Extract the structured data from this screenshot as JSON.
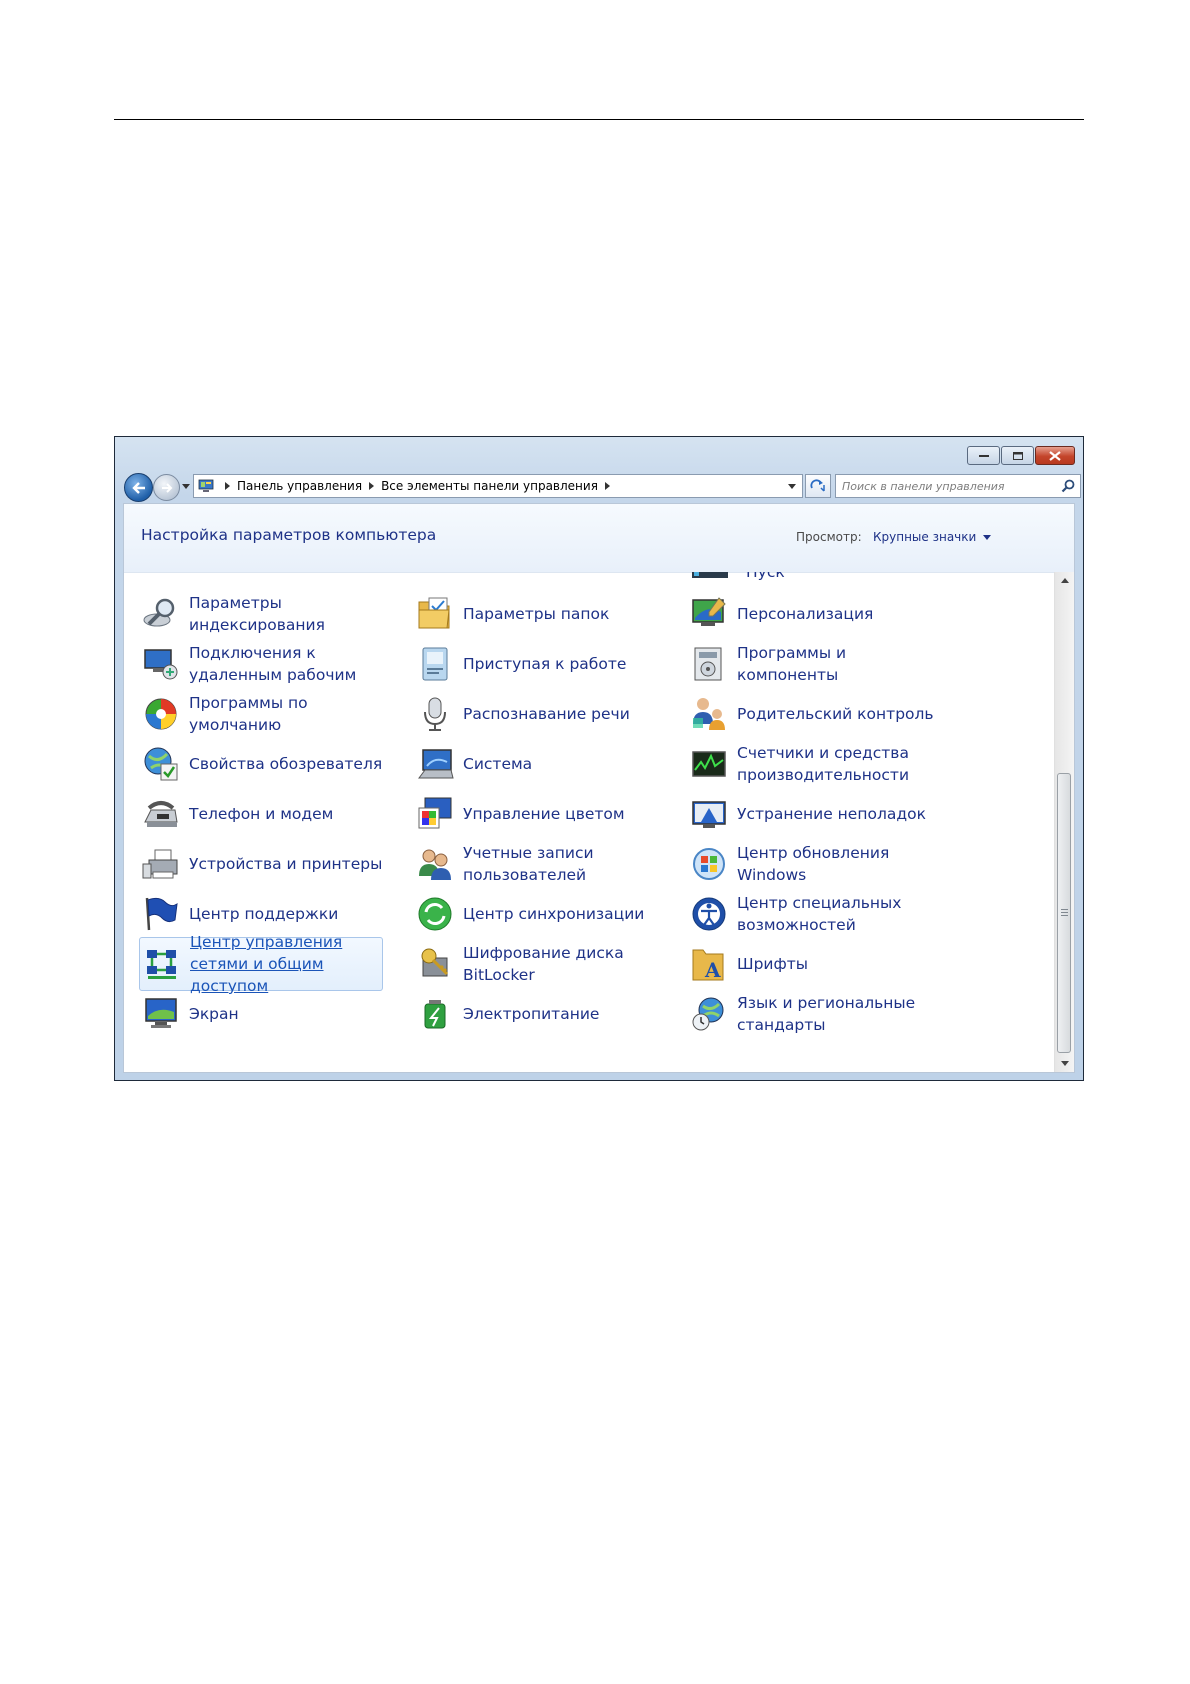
{
  "window": {
    "controls": [
      "minimize",
      "maximize",
      "close"
    ],
    "address_path": [
      "Панель управления",
      "Все элементы панели управления"
    ],
    "search_placeholder": "Поиск в панели управления"
  },
  "header": {
    "title": "Настройка параметров компьютера",
    "view_label": "Просмотр:",
    "view_value": "Крупные значки"
  },
  "partial_top": {
    "col1": "",
    "col2": "",
    "col3": "Пуск"
  },
  "items": {
    "col1": [
      {
        "label": "Параметры индексирования",
        "icon": "indexing-options-icon"
      },
      {
        "label": "Подключения к удаленным рабочим",
        "icon": "remote-desktop-icon"
      },
      {
        "label": "Программы по умолчанию",
        "icon": "default-programs-icon"
      },
      {
        "label": "Свойства обозревателя",
        "icon": "internet-options-icon"
      },
      {
        "label": "Телефон и модем",
        "icon": "phone-modem-icon"
      },
      {
        "label": "Устройства и принтеры",
        "icon": "devices-printers-icon"
      },
      {
        "label": "Центр поддержки",
        "icon": "action-center-flag-icon"
      },
      {
        "label": "Центр управления сетями и общим доступом",
        "icon": "network-center-icon",
        "selected": true
      },
      {
        "label": "Экран",
        "icon": "display-icon"
      }
    ],
    "col2": [
      {
        "label": "Параметры папок",
        "icon": "folder-options-icon"
      },
      {
        "label": "Приступая к работе",
        "icon": "getting-started-icon"
      },
      {
        "label": "Распознавание речи",
        "icon": "microphone-icon"
      },
      {
        "label": "Система",
        "icon": "system-icon"
      },
      {
        "label": "Управление цветом",
        "icon": "color-management-icon"
      },
      {
        "label": "Учетные записи пользователей",
        "icon": "user-accounts-icon"
      },
      {
        "label": "Центр синхронизации",
        "icon": "sync-center-icon"
      },
      {
        "label": "Шифрование диска BitLocker",
        "icon": "bitlocker-key-icon"
      },
      {
        "label": "Электропитание",
        "icon": "power-options-icon"
      }
    ],
    "col3": [
      {
        "label": "Персонализация",
        "icon": "personalization-icon"
      },
      {
        "label": "Программы и компоненты",
        "icon": "programs-features-icon"
      },
      {
        "label": "Родительский контроль",
        "icon": "parental-controls-icon"
      },
      {
        "label": "Счетчики и средства производительности",
        "icon": "performance-icon"
      },
      {
        "label": "Устранение неполадок",
        "icon": "troubleshooting-icon"
      },
      {
        "label": "Центр обновления Windows",
        "icon": "windows-update-icon"
      },
      {
        "label": "Центр специальных возможностей",
        "icon": "ease-of-access-icon"
      },
      {
        "label": "Шрифты",
        "icon": "fonts-icon"
      },
      {
        "label": "Язык и региональные стандарты",
        "icon": "region-language-icon"
      }
    ]
  },
  "colors": {
    "link": "#1e3287",
    "selected_border": "#a9c6ea"
  }
}
